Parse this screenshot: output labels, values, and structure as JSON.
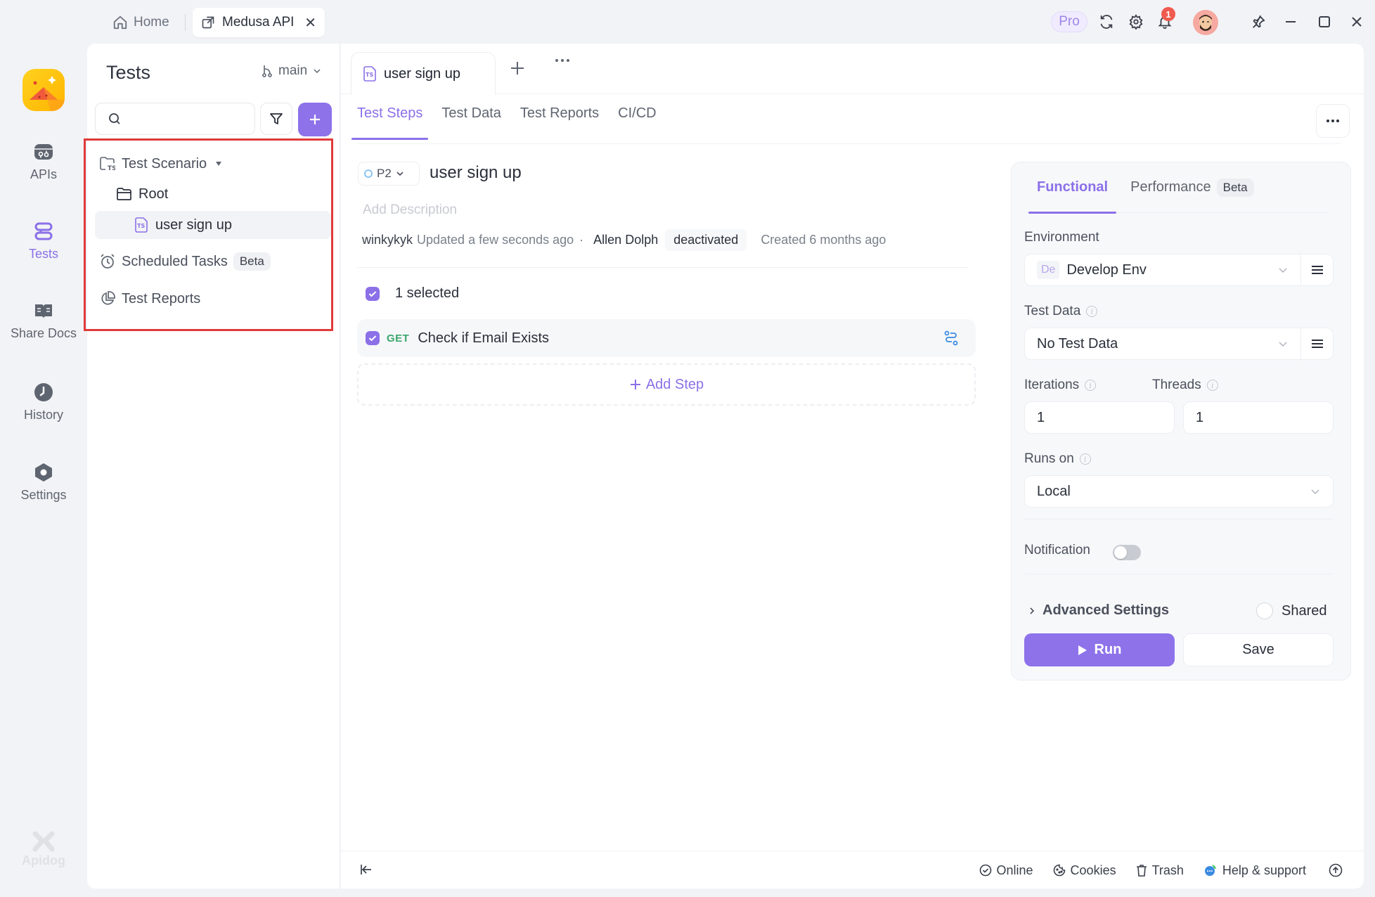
{
  "titlebar": {
    "home_tab": "Home",
    "project_tab": "Medusa API",
    "pro_badge": "Pro",
    "notification_count": "1",
    "icons": [
      "home-icon",
      "open-external-icon",
      "close-icon",
      "refresh-icon",
      "gear-icon",
      "bell-icon",
      "avatar",
      "pin-icon",
      "minimize-icon",
      "maximize-icon",
      "window-close-icon"
    ]
  },
  "rail": {
    "items": [
      {
        "label": "APIs",
        "icon": "api-icon",
        "active": false
      },
      {
        "label": "Tests",
        "icon": "tests-icon",
        "active": true
      },
      {
        "label": "Share Docs",
        "icon": "book-icon",
        "active": false
      },
      {
        "label": "History",
        "icon": "clock-icon",
        "active": false
      },
      {
        "label": "Settings",
        "icon": "settings-hex-icon",
        "active": false
      }
    ],
    "footer_brand": "Apidog"
  },
  "tree": {
    "title": "Tests",
    "branch": "main",
    "search_placeholder": "",
    "items": [
      {
        "label": "Test Scenario",
        "icon": "scenario-folder-icon",
        "has_caret": true
      },
      {
        "label": "Root",
        "icon": "folder-icon"
      },
      {
        "label": "user sign up",
        "icon": "ts-file-icon",
        "selected": true
      },
      {
        "label": "Scheduled Tasks",
        "icon": "alarm-icon",
        "badge": "Beta"
      },
      {
        "label": "Test Reports",
        "icon": "pie-chart-icon"
      }
    ]
  },
  "main": {
    "doc_tab": "user sign up",
    "sub_tabs": [
      {
        "label": "Test Steps",
        "active": true
      },
      {
        "label": "Test Data",
        "active": false
      },
      {
        "label": "Test Reports",
        "active": false
      },
      {
        "label": "CI/CD",
        "active": false
      }
    ],
    "priority": "P2",
    "case_name": "user sign up",
    "description_placeholder": "Add Description",
    "meta": {
      "updated_by": "winkykyk",
      "updated_text": "Updated a few seconds ago",
      "separator": "·",
      "owner": "Allen Dolph",
      "owner_status": "deactivated",
      "created_text": "Created 6 months ago"
    },
    "selected_count_text": "1 selected",
    "steps": [
      {
        "method": "GET",
        "name": "Check if Email Exists",
        "checked": true
      }
    ],
    "add_step_label": "Add Step"
  },
  "config": {
    "tabs": [
      {
        "label": "Functional",
        "active": true
      },
      {
        "label": "Performance",
        "badge": "Beta",
        "active": false
      }
    ],
    "environment": {
      "label": "Environment",
      "tag": "De",
      "value": "Develop Env"
    },
    "test_data": {
      "label": "Test Data",
      "value": "No Test Data"
    },
    "iterations": {
      "label": "Iterations",
      "value": "1"
    },
    "threads": {
      "label": "Threads",
      "value": "1"
    },
    "runs_on": {
      "label": "Runs on",
      "value": "Local"
    },
    "notification": {
      "label": "Notification",
      "enabled": false
    },
    "advanced_settings_label": "Advanced Settings",
    "shared": {
      "label": "Shared",
      "checked": false
    },
    "run_label": "Run",
    "save_label": "Save"
  },
  "footer": {
    "items": [
      {
        "label": "Online",
        "icon": "check-circle-icon"
      },
      {
        "label": "Cookies",
        "icon": "cookie-icon"
      },
      {
        "label": "Trash",
        "icon": "trash-icon"
      },
      {
        "label": "Help & support",
        "icon": "chat-bubble-icon"
      }
    ]
  },
  "colors": {
    "accent": "#8b70e8",
    "button_primary": "#8d72ea",
    "get_method": "#3aa76d",
    "notification_badge": "#f05a4f",
    "highlight_border": "#e03a3a"
  }
}
